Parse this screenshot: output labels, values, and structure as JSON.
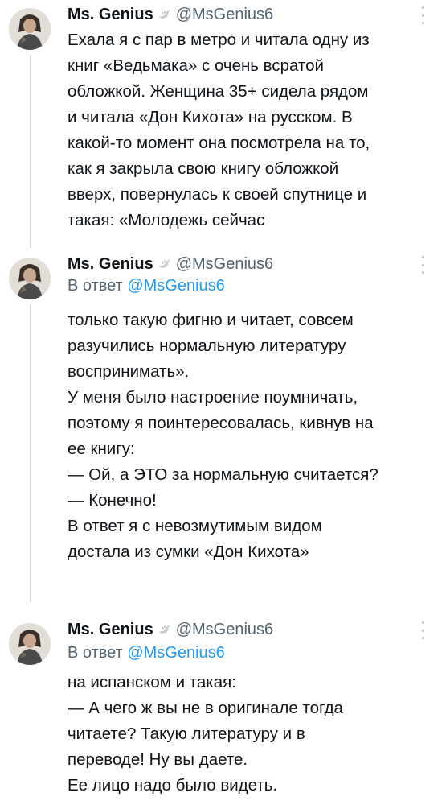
{
  "colors": {
    "text": "#0f1419",
    "secondary": "#536471",
    "link": "#1d9bf0",
    "thread_line": "#cfd9de"
  },
  "tweets": [
    {
      "author_name": "Ms. Genius",
      "badge_icon": "dove-icon",
      "handle": "@MsGenius6",
      "reply_prefix": "",
      "reply_handle": "",
      "lines": [
        "Ехала я с пар в метро и читала одну из",
        "книг «Ведьмака» с очень всратой",
        "обложкой. Женщина 35+ сидела рядом",
        "и читала «Дон Кихота» на русском. В",
        "какой-то момент она посмотрела на то,",
        "как я закрыла свою книгу обложкой",
        "вверх, повернулась к своей спутнице и",
        "такая: «Молодежь сейчас"
      ]
    },
    {
      "author_name": "Ms. Genius",
      "badge_icon": "dove-icon",
      "handle": "@MsGenius6",
      "reply_prefix": "В ответ",
      "reply_handle": "@MsGenius6",
      "lines": [
        "только такую фигню и читает, совсем",
        "разучились нормальную литературу",
        "воспринимать».",
        "У меня было настроение поумничать,",
        "поэтому я поинтересовалась, кивнув на",
        "ее книгу:",
        "— Ой, а ЭТО за нормальную считается?",
        "— Конечно!",
        "В ответ я с невозмутимым видом",
        "достала из сумки «Дон Кихота»"
      ]
    },
    {
      "author_name": "Ms. Genius",
      "badge_icon": "dove-icon",
      "handle": "@MsGenius6",
      "reply_prefix": "В ответ",
      "reply_handle": "@MsGenius6",
      "lines": [
        "на испанском и такая:",
        "— А чего ж вы не в оригинале тогда",
        "читаете? Такую литературу и в",
        "переводе! Ну вы даете.",
        "Ее лицо надо было видеть."
      ]
    }
  ]
}
